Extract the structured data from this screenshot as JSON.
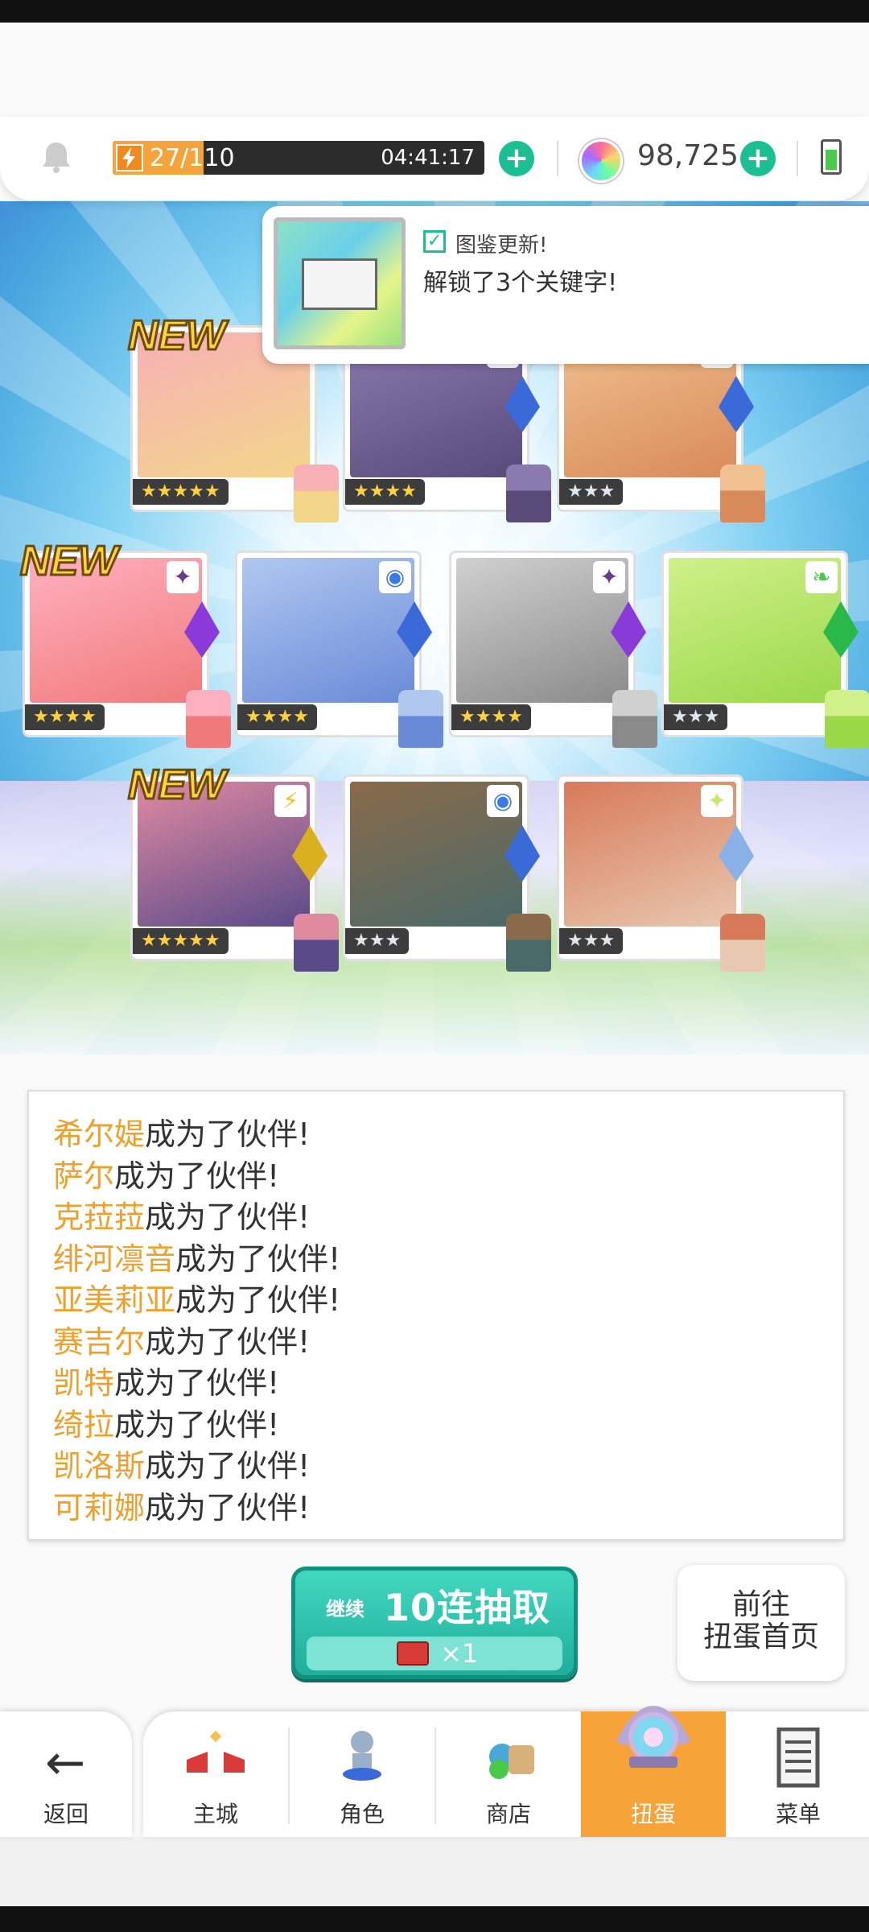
{
  "header": {
    "stamina_text": "27/110",
    "stamina_fraction": 0.245,
    "stamina_timer": "04:41:17",
    "gem_count": "98,725"
  },
  "notification": {
    "title": "图鉴更新!",
    "message": "解锁了3个关键字!"
  },
  "cards": [
    {
      "new": true,
      "stars": "★★★★★",
      "element": "none",
      "portrait": "#f3d58a",
      "accent": "#f7b0b6",
      "new_label": "NEW"
    },
    {
      "new": false,
      "stars": "★★★★",
      "element": "water",
      "portrait": "#5a4a7a",
      "accent": "#8a7ab0",
      "new_label": ""
    },
    {
      "new": false,
      "stars": "★★★",
      "element": "water",
      "portrait": "#d98a5a",
      "accent": "#f0c090",
      "new_label": ""
    },
    {
      "new": true,
      "stars": "★★★★",
      "element": "dark",
      "portrait": "#f07a7a",
      "accent": "#ffb0c0",
      "new_label": "NEW"
    },
    {
      "new": false,
      "stars": "★★★★",
      "element": "water",
      "portrait": "#6a8ad8",
      "accent": "#b0c8f0",
      "new_label": ""
    },
    {
      "new": false,
      "stars": "★★★★",
      "element": "dark",
      "portrait": "#8a8a8a",
      "accent": "#d0d0d0",
      "new_label": ""
    },
    {
      "new": false,
      "stars": "★★★",
      "element": "wind",
      "portrait": "#9ad84a",
      "accent": "#d0f08a",
      "new_label": ""
    },
    {
      "new": true,
      "stars": "★★★★★",
      "element": "thunder",
      "portrait": "#5a4a8a",
      "accent": "#e08aa0",
      "new_label": "NEW"
    },
    {
      "new": false,
      "stars": "★★★",
      "element": "water",
      "portrait": "#4a6a6a",
      "accent": "#8a6a4a",
      "new_label": ""
    },
    {
      "new": false,
      "stars": "★★★",
      "element": "light",
      "portrait": "#e8c8b0",
      "accent": "#d87a5a",
      "new_label": ""
    }
  ],
  "log": [
    {
      "name": "希尔媞",
      "suffix": "成为了伙伴!"
    },
    {
      "name": "萨尔",
      "suffix": "成为了伙伴!"
    },
    {
      "name": "克菈菈",
      "suffix": "成为了伙伴!"
    },
    {
      "name": "绯河凛音",
      "suffix": "成为了伙伴!"
    },
    {
      "name": "亚美莉亚",
      "suffix": "成为了伙伴!"
    },
    {
      "name": "赛吉尔",
      "suffix": "成为了伙伴!"
    },
    {
      "name": "凯特",
      "suffix": "成为了伙伴!"
    },
    {
      "name": "绮拉",
      "suffix": "成为了伙伴!"
    },
    {
      "name": "凯洛斯",
      "suffix": "成为了伙伴!"
    },
    {
      "name": "可莉娜",
      "suffix": "成为了伙伴!"
    }
  ],
  "actions": {
    "continue_label": "继续",
    "pull_label": "10连抽取",
    "pull_cost": "×1",
    "home_line1": "前往",
    "home_line2": "扭蛋首页"
  },
  "nav": {
    "back": "返回",
    "items": [
      {
        "label": "主城",
        "icon": "castle-icon"
      },
      {
        "label": "角色",
        "icon": "character-icon"
      },
      {
        "label": "商店",
        "icon": "shop-icon"
      },
      {
        "label": "扭蛋",
        "icon": "gacha-icon"
      },
      {
        "label": "菜单",
        "icon": "menu-icon"
      }
    ],
    "active_index": 3
  },
  "colors": {
    "accent_green": "#1bbf94",
    "name_orange": "#f0a02a",
    "active_tab": "#f7a33a",
    "new_tag": "#ffd33a"
  }
}
